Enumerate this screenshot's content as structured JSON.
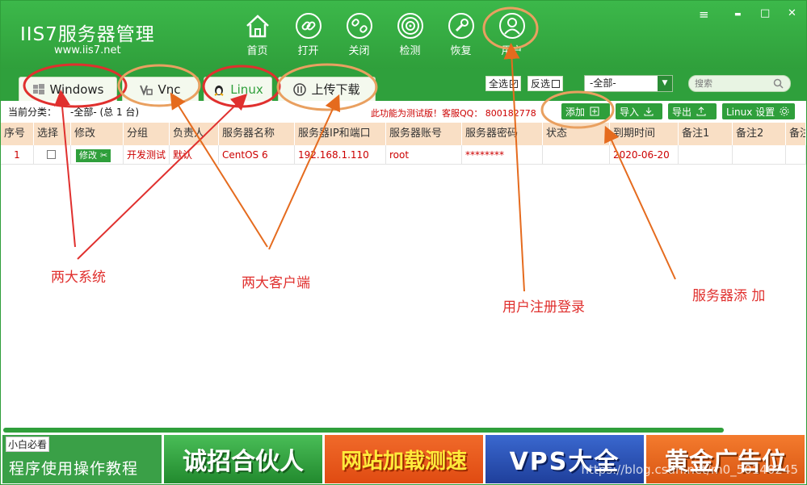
{
  "app": {
    "logo_title": "IIS7服务器管理",
    "logo_url": "www.iis7.net"
  },
  "nav": [
    {
      "label": "首页",
      "icon": "home-icon"
    },
    {
      "label": "打开",
      "icon": "link-icon"
    },
    {
      "label": "关闭",
      "icon": "unlink-icon"
    },
    {
      "label": "检测",
      "icon": "radar-icon"
    },
    {
      "label": "恢复",
      "icon": "wrench-icon"
    },
    {
      "label": "用户",
      "icon": "user-icon"
    }
  ],
  "window_controls": [
    "≡",
    "▬",
    "□",
    "✕"
  ],
  "tabs": [
    {
      "label": "Windows"
    },
    {
      "label": "Vnc"
    },
    {
      "label": "Linux"
    },
    {
      "label": "上传下载"
    }
  ],
  "list_controls": {
    "select_all": "全选",
    "invert": "反选",
    "group_select": "-全部-",
    "search_placeholder": "搜索"
  },
  "toolbar": {
    "category_label": "当前分类：",
    "category_value": "-全部- (总 1 台)",
    "notice": "此功能为测试版！客服QQ：  800182778",
    "add": "添加",
    "import": "导入",
    "export": "导出",
    "linux_settings": "Linux 设置"
  },
  "table": {
    "headers": [
      "序号",
      "选择",
      "修改",
      "分组",
      "负责人",
      "服务器名称",
      "服务器IP和端口",
      "服务器账号",
      "服务器密码",
      "状态",
      "到期时间",
      "备注1",
      "备注2",
      "备注"
    ],
    "rows": [
      {
        "index": "1",
        "edit": "修改",
        "group": "开发测试",
        "owner": "默认",
        "name": "CentOS 6",
        "ip": "192.168.1.110",
        "account": "root",
        "password": "********",
        "status": "",
        "expire": "2020-06-20",
        "note1": "",
        "note2": "",
        "note3": ""
      }
    ]
  },
  "banners": {
    "tag": "小白必看",
    "tutorial": "程序使用操作教程",
    "partner": "诚招合伙人",
    "speed": "网站加载测速",
    "vps": "VPS大全",
    "ads": "黄金广告位",
    "watermark": "https://blog.csdn.net/m0_50140245"
  },
  "annotations": {
    "two_systems": "两大系统",
    "two_clients": "两大客户端",
    "user_login": "用户注册登录",
    "server_add": "服务器添 加"
  },
  "colors": {
    "brand_green": "#2f9f3b",
    "header_peach": "#f9dfc5",
    "annotation_red": "#e0302e",
    "annotation_orange": "#e56b1e"
  }
}
